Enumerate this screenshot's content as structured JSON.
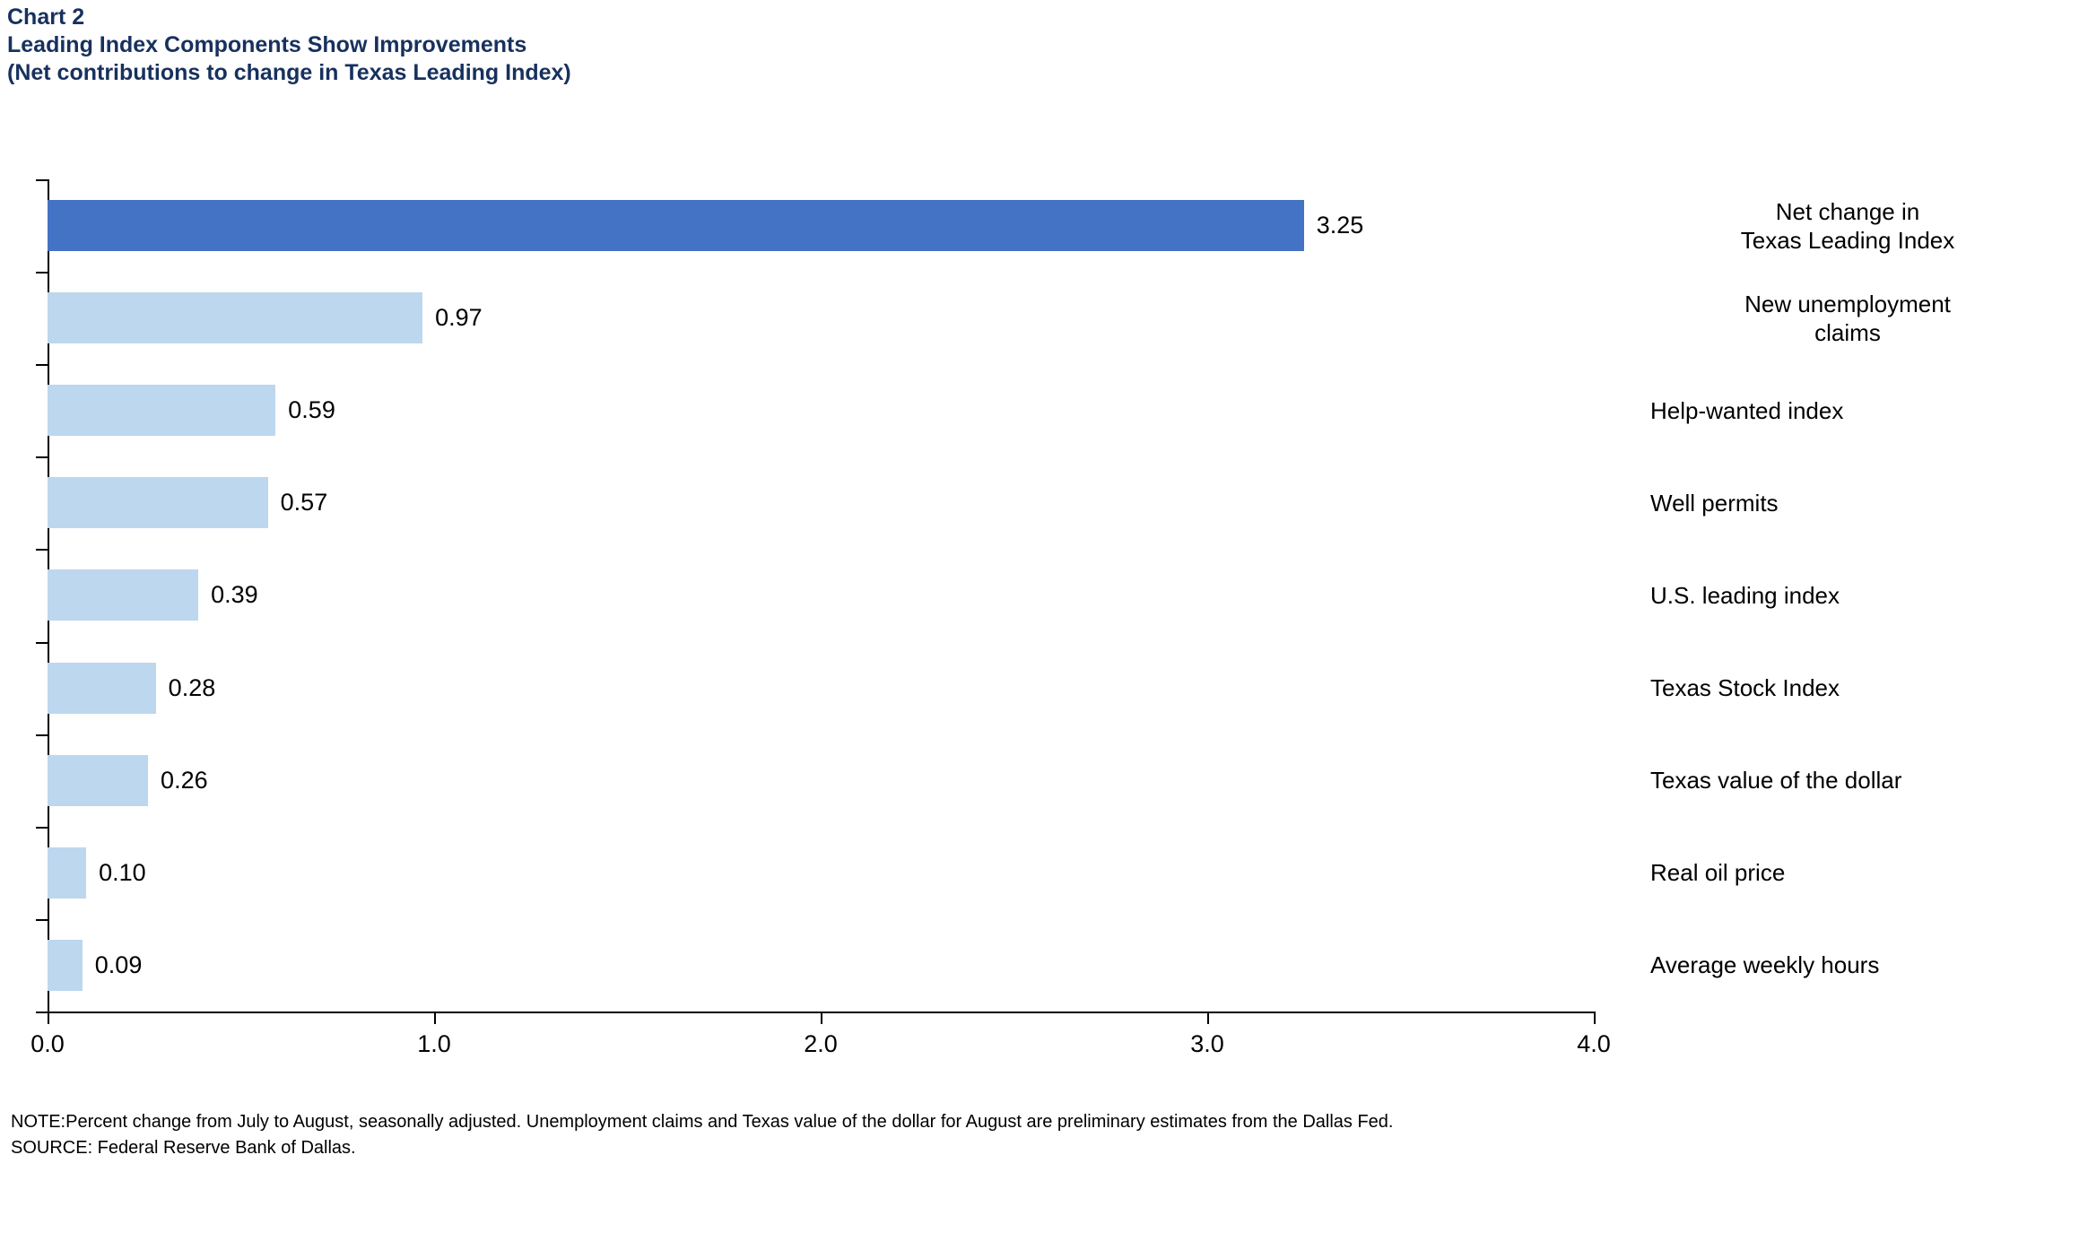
{
  "header": {
    "chart_number": "Chart 2",
    "title": "Leading Index Components Show Improvements",
    "subtitle": "(Net contributions to change in Texas Leading Index)"
  },
  "footnotes": {
    "note": "NOTE:Percent change from July to August, seasonally adjusted. Unemployment claims and Texas value of the dollar for August are preliminary estimates from the Dallas Fed.",
    "source": "SOURCE: Federal Reserve Bank of Dallas."
  },
  "colors": {
    "title": "#17315e",
    "highlight_bar": "#4472c4",
    "component_bar": "#bdd7ee",
    "axis": "#000000",
    "text": "#000000"
  },
  "chart_data": {
    "type": "bar",
    "orientation": "horizontal",
    "title": "Leading Index Components Show Improvements",
    "subtitle": "(Net contributions to change in Texas Leading Index)",
    "xlabel": "",
    "ylabel": "",
    "xlim": [
      0.0,
      4.0
    ],
    "xticks": [
      "0.0",
      "1.0",
      "2.0",
      "3.0",
      "4.0"
    ],
    "xtick_values": [
      0.0,
      1.0,
      2.0,
      3.0,
      4.0
    ],
    "grid": false,
    "legend": null,
    "categories": [
      "Net change in\nTexas Leading Index",
      "New unemployment\nclaims",
      "Help-wanted index",
      "Well permits",
      "U.S. leading index",
      "Texas Stock Index",
      "Texas value of the dollar",
      "Real oil price",
      "Average weekly hours"
    ],
    "values": [
      3.25,
      0.97,
      0.59,
      0.57,
      0.39,
      0.28,
      0.26,
      0.1,
      0.09
    ],
    "value_labels": [
      "3.25",
      "0.97",
      "0.59",
      "0.57",
      "0.39",
      "0.28",
      "0.26",
      "0.10",
      "0.09"
    ]
  },
  "bars": [
    {
      "label_line1": "Net change in",
      "label_line2": "Texas Leading Index",
      "value": 3.25,
      "value_label": "3.25",
      "color": "#4472c4",
      "align": "center"
    },
    {
      "label_line1": "New unemployment",
      "label_line2": "claims",
      "value": 0.97,
      "value_label": "0.97",
      "color": "#bdd7ee",
      "align": "center"
    },
    {
      "label_line1": "Help-wanted index",
      "label_line2": "",
      "value": 0.59,
      "value_label": "0.59",
      "color": "#bdd7ee",
      "align": "left"
    },
    {
      "label_line1": "Well permits",
      "label_line2": "",
      "value": 0.57,
      "value_label": "0.57",
      "color": "#bdd7ee",
      "align": "left"
    },
    {
      "label_line1": "U.S. leading index",
      "label_line2": "",
      "value": 0.39,
      "value_label": "0.39",
      "color": "#bdd7ee",
      "align": "left"
    },
    {
      "label_line1": "Texas Stock Index",
      "label_line2": "",
      "value": 0.28,
      "value_label": "0.28",
      "color": "#bdd7ee",
      "align": "left"
    },
    {
      "label_line1": "Texas value of the dollar",
      "label_line2": "",
      "value": 0.26,
      "value_label": "0.26",
      "color": "#bdd7ee",
      "align": "left"
    },
    {
      "label_line1": "Real oil price",
      "label_line2": "",
      "value": 0.1,
      "value_label": "0.10",
      "color": "#bdd7ee",
      "align": "left"
    },
    {
      "label_line1": "Average weekly hours",
      "label_line2": "",
      "value": 0.09,
      "value_label": "0.09",
      "color": "#bdd7ee",
      "align": "left"
    }
  ]
}
